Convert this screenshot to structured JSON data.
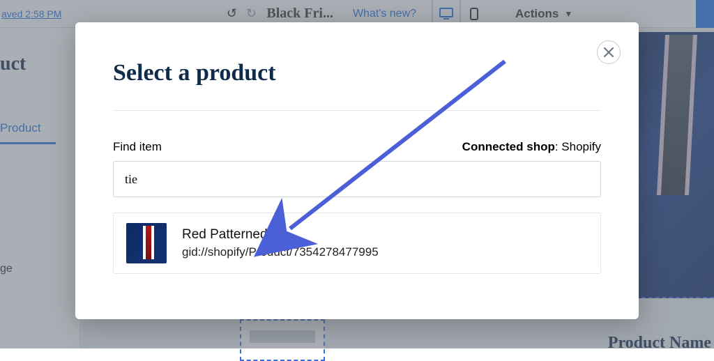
{
  "header": {
    "saved_label": "aved 2:58 PM",
    "page_label": "Black Fri...",
    "whats_new_label": "What's new?",
    "actions_label": "Actions"
  },
  "sidebar": {
    "title_fragment": "uct",
    "tab_label": "Product",
    "item_fragment": "ge"
  },
  "preview": {
    "caption_fragment": "Product Name"
  },
  "modal": {
    "title": "Select a product",
    "find_label": "Find item",
    "connected_label": "Connected shop",
    "connected_value": "Shopify",
    "search_value": "tie",
    "result": {
      "name": "Red Patterned Tie",
      "gid": "gid://shopify/Product/7354278477995"
    }
  }
}
